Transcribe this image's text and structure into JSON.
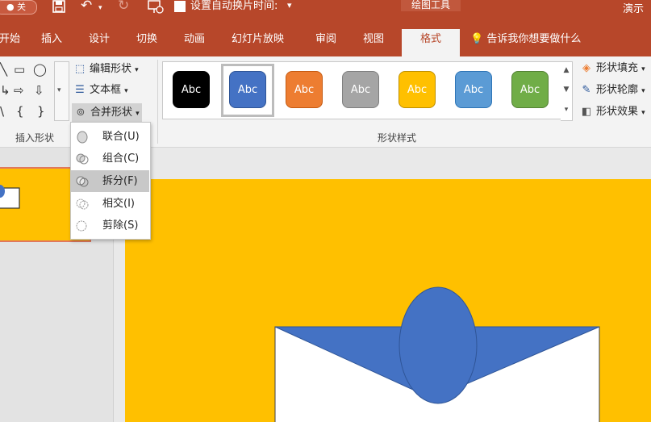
{
  "titlebar": {
    "autosave": "关",
    "auto_slide_checkbox_label": "设置自动换片时间:",
    "contextual_header": "绘图工具",
    "app_title": "演示"
  },
  "tabs": [
    {
      "label": "开始"
    },
    {
      "label": "插入"
    },
    {
      "label": "设计"
    },
    {
      "label": "切换"
    },
    {
      "label": "动画"
    },
    {
      "label": "幻灯片放映"
    },
    {
      "label": "审阅"
    },
    {
      "label": "视图"
    },
    {
      "label": "格式"
    }
  ],
  "tell_me": "告诉我你想要做什么",
  "ribbon": {
    "insert_shapes": {
      "label": "插入形状",
      "edit_shape": "编辑形状",
      "text_box": "文本框",
      "merge_shapes": "合并形状"
    },
    "shape_styles": {
      "label": "形状样式",
      "swatches": [
        {
          "text": "Abc",
          "color": "#000000",
          "border": "#000000"
        },
        {
          "text": "Abc",
          "color": "#4472C4",
          "border": "#2F5597"
        },
        {
          "text": "Abc",
          "color": "#ED7D31",
          "border": "#C55A11"
        },
        {
          "text": "Abc",
          "color": "#A5A5A5",
          "border": "#7F7F7F"
        },
        {
          "text": "Abc",
          "color": "#FFC000",
          "border": "#BF9000"
        },
        {
          "text": "Abc",
          "color": "#5B9BD5",
          "border": "#2E75B6"
        },
        {
          "text": "Abc",
          "color": "#70AD47",
          "border": "#548235"
        }
      ],
      "fill": "形状填充",
      "outline": "形状轮廓",
      "effects": "形状效果"
    }
  },
  "merge_menu": [
    {
      "label": "联合(U)"
    },
    {
      "label": "组合(C)"
    },
    {
      "label": "拆分(F)"
    },
    {
      "label": "相交(I)"
    },
    {
      "label": "剪除(S)"
    }
  ],
  "colors": {
    "accent": "#B7472A",
    "slide_bg": "#FFC000",
    "shape_blue": "#4472C4"
  }
}
